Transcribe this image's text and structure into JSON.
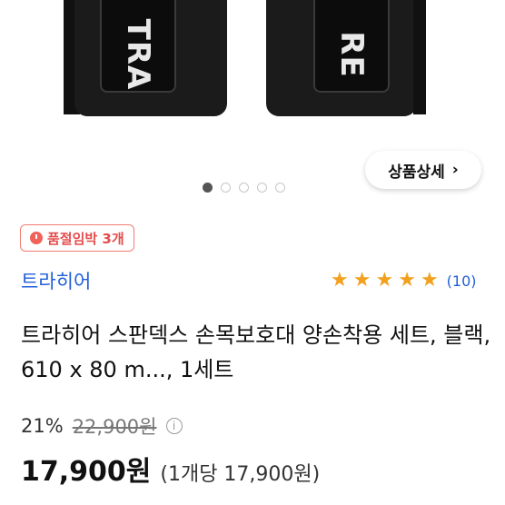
{
  "hero": {
    "patch_left_text": "TRA",
    "patch_right_text": "RE",
    "detail_button_label": "상품상세",
    "detail_button_chevron": "›",
    "carousel_dots": 5,
    "carousel_active_index": 0
  },
  "badge": {
    "icon": "alarm-clock-icon",
    "label": "품절임박 3개"
  },
  "brand": {
    "name": "트라히어"
  },
  "rating": {
    "stars": 5,
    "star_color": "#f2a11f",
    "review_count": "(10)"
  },
  "product": {
    "title": "트라히어 스판덱스 손목보호대 양손착용 세트, 블랙, 610 x 80 m..., 1세트"
  },
  "pricing": {
    "discount": "21%",
    "original_price": "22,900원",
    "price": "17,900원",
    "unit_price": "(1개당 17,900원)"
  },
  "colors": {
    "brand_blue": "#1f5fd8",
    "badge_red": "#e54b4b"
  }
}
